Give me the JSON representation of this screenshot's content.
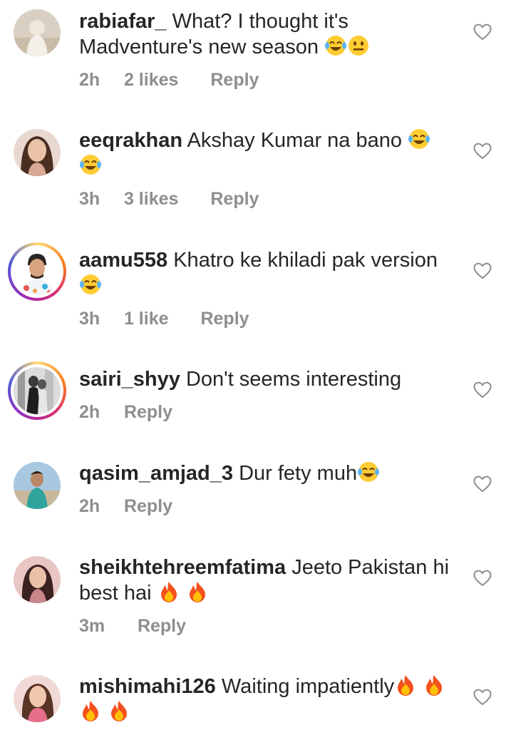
{
  "comments": [
    {
      "username": "rabiafar_",
      "text": "What? I thought it's Madventure's new season",
      "emoji": [
        "face-with-tears-of-joy",
        "neutral-face"
      ],
      "time": "2h",
      "likes": "2 likes",
      "reply": "Reply"
    },
    {
      "username": "eeqrakhan",
      "text": "Akshay Kumar na bano",
      "emoji": [
        "face-with-tears-of-joy",
        "face-with-tears-of-joy"
      ],
      "time": "3h",
      "likes": "3 likes",
      "reply": "Reply"
    },
    {
      "username": "aamu558",
      "text": "Khatro ke khiladi pak version",
      "emoji": [
        "face-with-tears-of-joy"
      ],
      "time": "3h",
      "likes": "1 like",
      "reply": "Reply"
    },
    {
      "username": "sairi_shyy",
      "text": "Don't seems interesting",
      "emoji": [],
      "time": "2h",
      "likes": "",
      "reply": "Reply"
    },
    {
      "username": "qasim_amjad_3",
      "text": "Dur fety muh",
      "emoji": [
        "face-with-tears-of-joy"
      ],
      "time": "2h",
      "likes": "",
      "reply": "Reply"
    },
    {
      "username": "sheikhtehreemfatima",
      "text": "Jeeto Pakistan hi best hai",
      "emoji": [
        "fire",
        "fire"
      ],
      "time": "3m",
      "likes": "",
      "reply": "Reply"
    },
    {
      "username": "mishimahi126",
      "text": "Waiting impatiently",
      "emoji": [
        "fire",
        "fire",
        "fire",
        "fire"
      ],
      "time": "",
      "likes": "",
      "reply": ""
    }
  ],
  "colors": {
    "text": "#262626",
    "meta": "#8e8e8e",
    "heart_stroke": "#8e8e8e"
  },
  "icons": {
    "like": "heart-outline-icon"
  }
}
